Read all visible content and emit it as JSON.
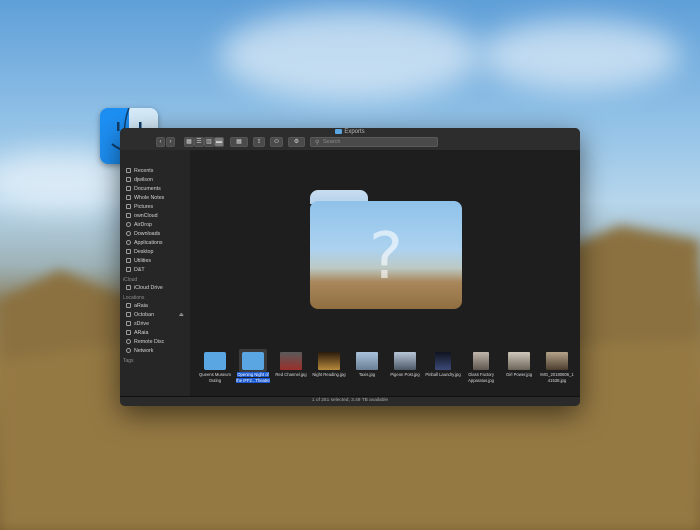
{
  "window": {
    "title": "Exports"
  },
  "toolbar": {
    "back": "‹",
    "forward": "›",
    "view_icons": "▦",
    "view_list": "☰",
    "view_columns": "▥",
    "view_gallery": "▬",
    "group": "▦",
    "share": "⇪",
    "tag": "⬭",
    "action": "⚙",
    "search_placeholder": "Search"
  },
  "sidebar": {
    "favorites": [
      {
        "label": "Recents"
      },
      {
        "label": "djwilson"
      },
      {
        "label": "Documents"
      },
      {
        "label": "Whole Notes"
      },
      {
        "label": "Pictures"
      },
      {
        "label": "ownCloud"
      },
      {
        "label": "AirDrop"
      },
      {
        "label": "Downloads"
      },
      {
        "label": "Applications"
      },
      {
        "label": "Desktop"
      },
      {
        "label": "Utilities"
      },
      {
        "label": "D&T"
      }
    ],
    "icloud_header": "iCloud",
    "icloud": [
      {
        "label": "iCloud Drive"
      }
    ],
    "locations_header": "Locations",
    "locations": [
      {
        "label": "aRaia"
      },
      {
        "label": "Octoban",
        "eject": "⏏"
      },
      {
        "label": "sDrive"
      },
      {
        "label": "ARaia"
      },
      {
        "label": "Remote Disc"
      },
      {
        "label": "Network"
      }
    ],
    "tags_header": "Tags"
  },
  "preview": {
    "icon": "folder-question-icon",
    "glyph": "?"
  },
  "files": [
    {
      "name": "Queens Museum Outing",
      "kind": "folder",
      "color": "#5aa6e2"
    },
    {
      "name": "Opening Night of the IFF2...Theatre",
      "kind": "folder",
      "selected": true,
      "color": "#5aa6e2"
    },
    {
      "name": "Red Channel.jpg",
      "kind": "image",
      "color": "#7c2a26"
    },
    {
      "name": "Night Reading.jpg",
      "kind": "image",
      "color": "#3c2a16"
    },
    {
      "name": "Taxis.jpg",
      "kind": "image",
      "color": "#7d9fc0"
    },
    {
      "name": "Pigeon Post.jpg",
      "kind": "image",
      "color": "#8799ae"
    },
    {
      "name": "Pinball Laundry.jpg",
      "kind": "image",
      "color": "#202438"
    },
    {
      "name": "Glass Factory Apparatus.jpg",
      "kind": "image",
      "color": "#8a7f79"
    },
    {
      "name": "Girl Power.jpg",
      "kind": "image",
      "color": "#a09a8e"
    },
    {
      "name": "IMG_20180806_1 41538.jpg",
      "kind": "image",
      "color": "#7f6d5a"
    }
  ],
  "status": {
    "text": "1 of 251 selected, 3.49 TB available"
  }
}
